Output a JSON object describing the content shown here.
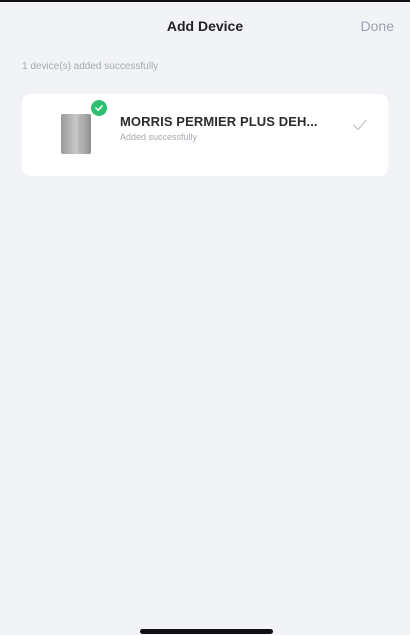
{
  "nav": {
    "title": "Add Device",
    "done_label": "Done"
  },
  "section": {
    "label": "1 device(s) added successfully"
  },
  "device": {
    "name": "MORRIS PERMIER PLUS DEH...",
    "status": "Added successfully",
    "icon": "dehumidifier-icon",
    "badge_icon": "check-badge-icon",
    "trailing_icon": "check-icon"
  },
  "colors": {
    "background": "#f2f3f7",
    "card": "#ffffff",
    "success": "#2fbf71",
    "muted": "#a6a9b2",
    "done": "#9aa3b2"
  }
}
